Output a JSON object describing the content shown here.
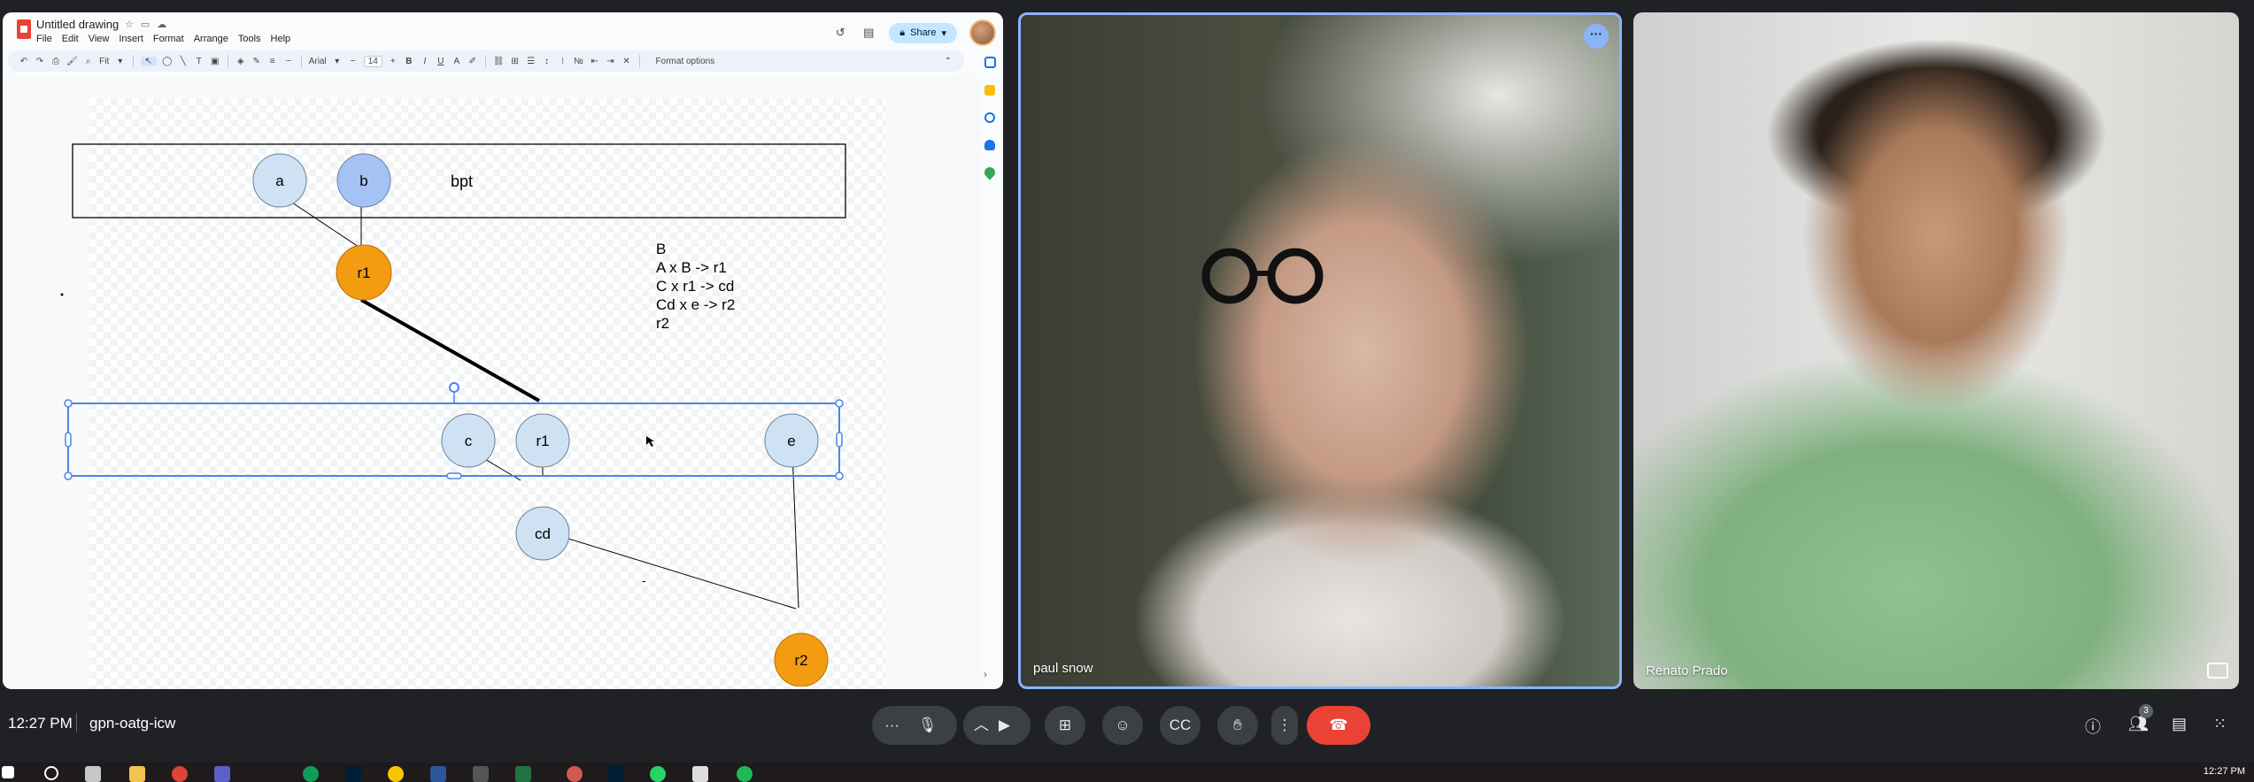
{
  "drawings": {
    "doc_title": "Untitled drawing",
    "menu": [
      "File",
      "Edit",
      "View",
      "Insert",
      "Format",
      "Arrange",
      "Tools",
      "Help"
    ],
    "share_label": "Share",
    "toolbar": {
      "zoom": "Fit",
      "font": "Arial",
      "font_size": "14",
      "format_options": "Format options"
    },
    "canvas": {
      "bpt_label": "bpt",
      "nodes": {
        "a": "a",
        "b": "b",
        "r1_top": "r1",
        "c": "c",
        "r1_mid": "r1",
        "e": "e",
        "cd": "cd",
        "r2": "r2"
      },
      "notes": [
        "B",
        "A x B -> r1",
        "C x r1 -> cd",
        "Cd x e -> r2",
        "r2"
      ],
      "dash": "-",
      "colors": {
        "light_node": "#cfe2f3",
        "selected_node": "#a4c2f4",
        "result_node": "#f39c12",
        "selection": "#4a86e8"
      }
    }
  },
  "participants": [
    {
      "name": "paul snow"
    },
    {
      "name": "Renato Prado"
    }
  ],
  "meet": {
    "time": "12:27 PM",
    "meeting_code": "gpn-oatg-icw",
    "people_count": "3",
    "controls": [
      "more-dots",
      "microphone",
      "caret-up",
      "camera",
      "present",
      "emoji",
      "captions",
      "raise-hand",
      "more-options",
      "end-call"
    ],
    "right_controls": [
      "info",
      "people",
      "chat",
      "activities"
    ]
  },
  "taskbar": {
    "clock": "12:27 PM"
  }
}
